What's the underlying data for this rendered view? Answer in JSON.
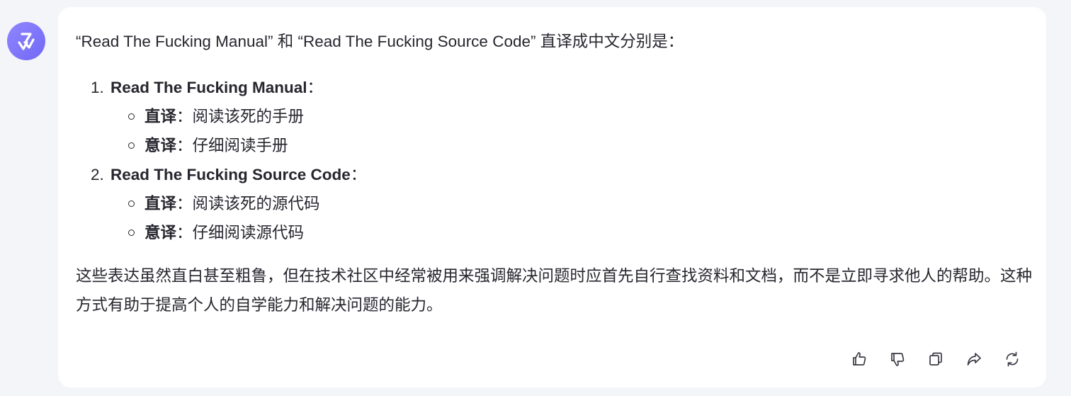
{
  "message": {
    "intro": "“Read The Fucking Manual” 和 “Read The Fucking Source Code” 直译成中文分别是：",
    "items": [
      {
        "number": "1.",
        "title": "Read The Fucking Manual",
        "colon": "：",
        "subitems": [
          {
            "label": "直译",
            "colon": "：",
            "text": "阅读该死的手册"
          },
          {
            "label": "意译",
            "colon": "：",
            "text": "仔细阅读手册"
          }
        ]
      },
      {
        "number": "2.",
        "title": "Read The Fucking Source Code",
        "colon": "：",
        "subitems": [
          {
            "label": "直译",
            "colon": "：",
            "text": "阅读该死的源代码"
          },
          {
            "label": "意译",
            "colon": "：",
            "text": "仔细阅读源代码"
          }
        ]
      }
    ],
    "summary": "这些表达虽然直白甚至粗鲁，但在技术社区中经常被用来强调解决问题时应首先自行查找资料和文档，而不是立即寻求他人的帮助。这种方式有助于提高个人的自学能力和解决问题的能力。"
  },
  "actions": [
    {
      "icon": "thumbs-up-icon"
    },
    {
      "icon": "thumbs-down-icon"
    },
    {
      "icon": "copy-icon"
    },
    {
      "icon": "share-icon"
    },
    {
      "icon": "regenerate-icon"
    }
  ],
  "colors": {
    "avatar": "#7b71f8",
    "background": "#f4f5f9",
    "bubble": "#ffffff",
    "text": "#26262e"
  }
}
